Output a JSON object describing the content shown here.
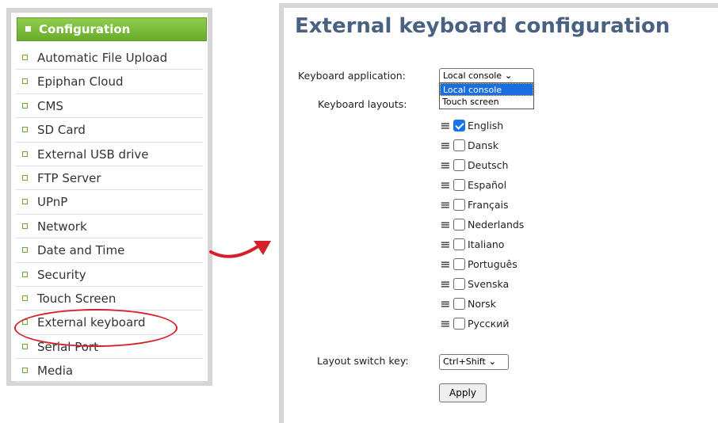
{
  "sidebar": {
    "header": "Configuration",
    "items": [
      {
        "label": "Automatic File Upload"
      },
      {
        "label": "Epiphan Cloud"
      },
      {
        "label": "CMS"
      },
      {
        "label": "SD Card"
      },
      {
        "label": "External USB drive"
      },
      {
        "label": "FTP Server"
      },
      {
        "label": "UPnP"
      },
      {
        "label": "Network"
      },
      {
        "label": "Date and Time"
      },
      {
        "label": "Security"
      },
      {
        "label": "Touch Screen"
      },
      {
        "label": "External keyboard"
      },
      {
        "label": "Serial Port"
      },
      {
        "label": "Media"
      }
    ]
  },
  "main": {
    "title": "External keyboard configuration",
    "keyboard_application_label": "Keyboard application:",
    "keyboard_application_value": "Local console",
    "keyboard_application_options": [
      "Local console",
      "Touch screen"
    ],
    "keyboard_layouts_label": "Keyboard layouts:",
    "layouts": [
      {
        "name": "English",
        "checked": true
      },
      {
        "name": "Dansk",
        "checked": false
      },
      {
        "name": "Deutsch",
        "checked": false
      },
      {
        "name": "Español",
        "checked": false
      },
      {
        "name": "Français",
        "checked": false
      },
      {
        "name": "Nederlands",
        "checked": false
      },
      {
        "name": "Italiano",
        "checked": false
      },
      {
        "name": "Português",
        "checked": false
      },
      {
        "name": "Svenska",
        "checked": false
      },
      {
        "name": "Norsk",
        "checked": false
      },
      {
        "name": "Русский",
        "checked": false
      }
    ],
    "layout_switch_label": "Layout switch key:",
    "layout_switch_value": "Ctrl+Shift",
    "apply_label": "Apply"
  },
  "icons": {
    "drag_handle": "≡",
    "chevron": "⌄"
  },
  "colors": {
    "header_green": "#7bbd3c",
    "title_blue": "#4a6282",
    "highlight_red": "#d4202a",
    "selection_blue": "#1a6fe0"
  }
}
